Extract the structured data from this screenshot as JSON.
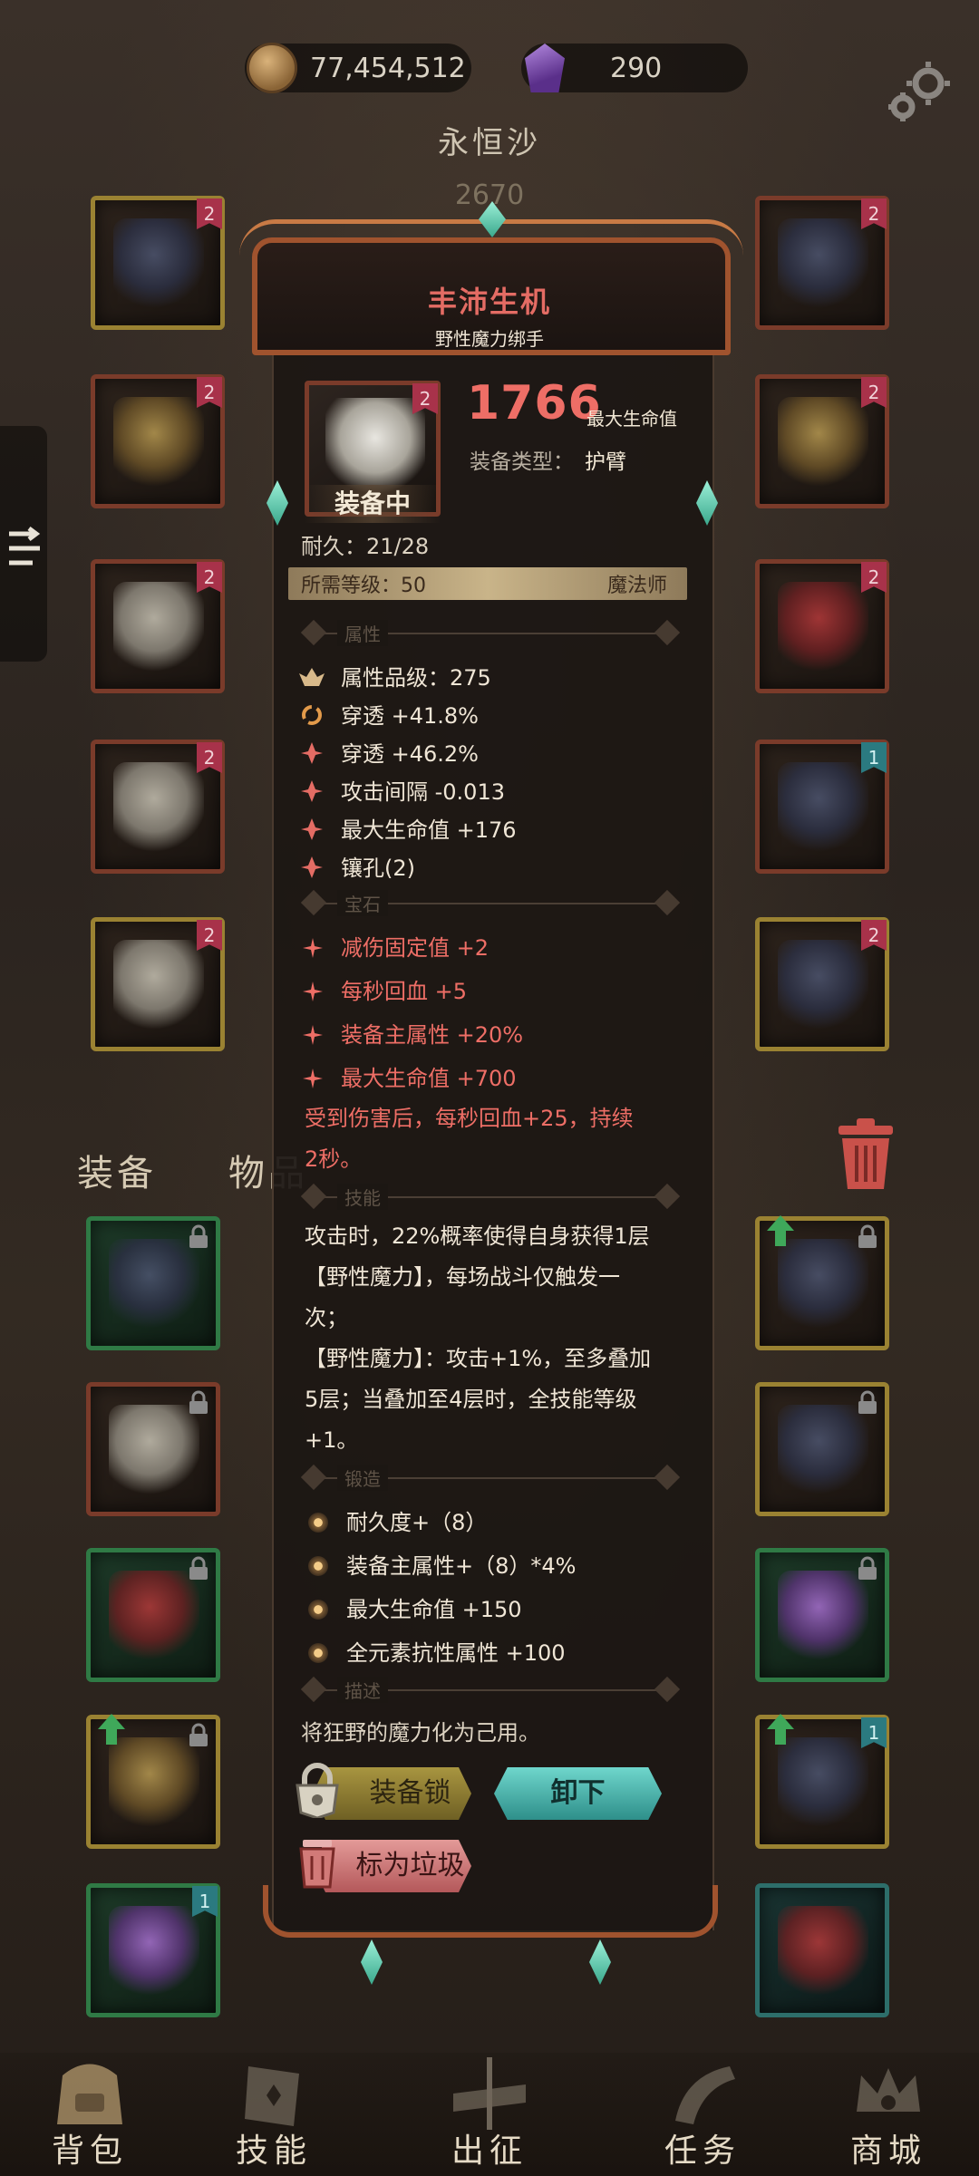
{
  "currency": {
    "gold": "77,454,512",
    "gems": "290"
  },
  "character": {
    "title": "永恒沙",
    "level": "2670"
  },
  "tabs": {
    "equip": "装备",
    "items": "物品"
  },
  "item": {
    "name": "丰沛生机",
    "subtitle": "野性魔力绑手",
    "tier_badge": "2",
    "equipped_label": "装备中",
    "main_stat_value": "1766",
    "main_stat_label": "最大生命值",
    "type_label": "装备类型：",
    "type_value": "护臂",
    "durability": "耐久：21/28",
    "required_level": "所需等级：50",
    "required_class": "魔法师",
    "sections": {
      "attributes": "属性",
      "gems": "宝石",
      "skills": "技能",
      "forge": "锻造",
      "description": "描述"
    },
    "attributes": [
      "属性品级：275",
      "穿透 +41.8%",
      "穿透 +46.2%",
      "攻击间隔 -0.013",
      "最大生命值 +176",
      "镶孔(2)"
    ],
    "gems": [
      "减伤固定值 +2",
      "每秒回血 +5",
      "装备主属性 +20%",
      "最大生命值 +700"
    ],
    "gem_set_line1": "受到伤害后，每秒回血+25，持续",
    "gem_set_line2": "2秒。",
    "skill_lines": [
      "攻击时，22%概率使得自身获得1层",
      "【野性魔力】，每场战斗仅触发一",
      "次；",
      "【野性魔力】：攻击+1%，至多叠加",
      "5层；当叠加至4层时，全技能等级",
      "+1。"
    ],
    "forge": [
      "耐久度+（8）",
      "装备主属性+（8）*4%",
      "最大生命值 +150",
      "全元素抗性属性 +100"
    ],
    "description": "将狂野的魔力化为己用。",
    "buttons": {
      "lock": "装备锁",
      "unequip": "卸下",
      "junk": "标为垃圾"
    }
  },
  "equipped_badges": [
    "2",
    "2",
    "2",
    "2",
    "2",
    "2",
    "2",
    "2",
    "2",
    "1"
  ],
  "bag_badges": [
    "1",
    "1"
  ],
  "nav": [
    {
      "label": "背包",
      "icon": "backpack-icon"
    },
    {
      "label": "技能",
      "icon": "skill-book-icon"
    },
    {
      "label": "出征",
      "icon": "sword-icon"
    },
    {
      "label": "任务",
      "icon": "horn-icon"
    },
    {
      "label": "商城",
      "icon": "shop-crown-icon"
    }
  ],
  "colors": {
    "accent_red": "#ee6e66",
    "frame_orange": "#a0532e",
    "teal_button": "#2e8f8a",
    "gold_button": "#a89540"
  }
}
